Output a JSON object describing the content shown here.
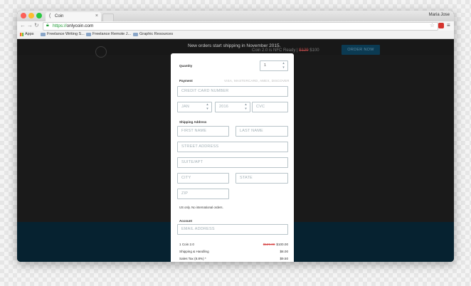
{
  "browser": {
    "tab_title": "Coin",
    "user_name": "Maria Jose",
    "url_scheme": "https://",
    "url_host": "onlycoin.com",
    "bookmarks": [
      {
        "label": "Apps"
      },
      {
        "label": "Freelance Writing S..."
      },
      {
        "label": "Freelance Remote J..."
      },
      {
        "label": "Graphic Resources"
      }
    ]
  },
  "page": {
    "banner_text": "New orders start shipping in November 2015.",
    "banner_sub_prefix": "Coin 2.0 is NFC Ready |",
    "banner_old_price": "$129",
    "banner_new_price": "$100",
    "order_button": "ORDER NOW"
  },
  "form": {
    "quantity_label": "Quantity",
    "quantity_value": "1",
    "payment_label": "Payment",
    "accepted_cards": "VISA, MASTERCARD, AMEX, DISCOVER",
    "card_number_placeholder": "CREDIT CARD NUMBER",
    "exp_month": "JAN",
    "exp_year": "2016",
    "cvc_placeholder": "CVC",
    "shipping_label": "Shipping Address",
    "first_name_placeholder": "FIRST NAME",
    "last_name_placeholder": "LAST NAME",
    "street_placeholder": "STREET ADDRESS",
    "suite_placeholder": "SUITE/APT",
    "city_placeholder": "CITY",
    "state_placeholder": "STATE",
    "zip_placeholder": "ZIP",
    "us_only_note": "US only. No international orders.",
    "account_label": "Account",
    "email_placeholder": "EMAIL ADDRESS"
  },
  "summary": {
    "product": "1 Coin 2.0",
    "product_old_price": "$129.00",
    "product_price": "$100.00",
    "shipping_label": "Shipping & Handling",
    "shipping_value": "$8.00",
    "tax_label": "Sales Tax (8.8%) *",
    "tax_value": "$9.50"
  },
  "colors": {
    "page_background": "#1a1a1a",
    "footer_band": "#062230",
    "order_button": "#0b3a52",
    "field_border": "#b8c4c9",
    "price_strike": "#d43c3c"
  },
  "icons": {
    "lock": "lock-icon",
    "star": "star-icon",
    "menu": "hamburger-icon",
    "close": "close-icon"
  }
}
